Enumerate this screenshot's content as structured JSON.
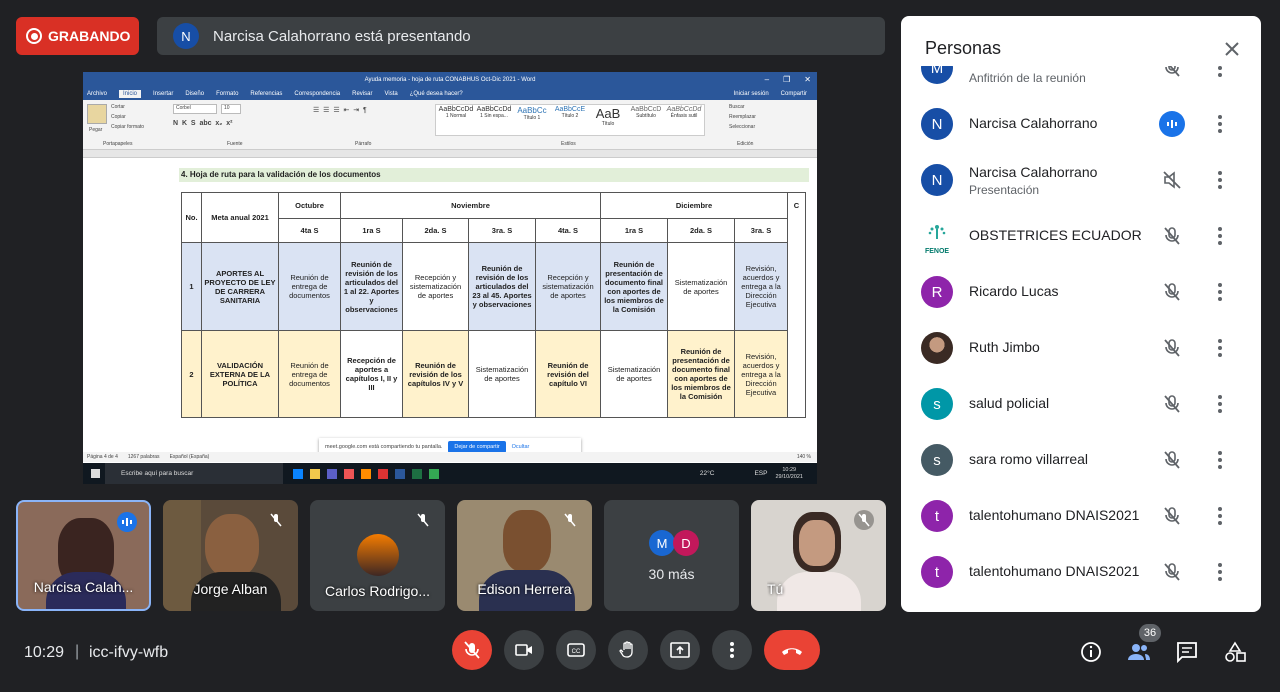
{
  "recording": {
    "label": "GRABANDO"
  },
  "presenting_banner": {
    "initial": "N",
    "text": "Narcisa Calahorrano está presentando"
  },
  "word": {
    "title": "Ayuda memoria - hoja de ruta CONABHUS Oct-Dic 2021 - Word",
    "tabs": [
      "Archivo",
      "Inicio",
      "Insertar",
      "Diseño",
      "Formato",
      "Referencias",
      "Correspondencia",
      "Revisar",
      "Vista",
      "¿Qué desea hacer?"
    ],
    "account": "Iniciar sesión",
    "share": "Compartir",
    "clipboard": [
      "Cortar",
      "Copiar",
      "Copiar formato"
    ],
    "paste": "Pegar",
    "font_name": "Corbel",
    "font_size": "10",
    "styles": [
      {
        "sample": "AaBbCcDd",
        "name": "1 Normal"
      },
      {
        "sample": "AaBbCcDd",
        "name": "1 Sin espa..."
      },
      {
        "sample": "AaBbCc",
        "name": "Título 1"
      },
      {
        "sample": "AaBbCcE",
        "name": "Título 2"
      },
      {
        "sample": "AaB",
        "name": "Título"
      },
      {
        "sample": "AaBbCcD",
        "name": "Subtítulo"
      },
      {
        "sample": "AaBbCcDd",
        "name": "Énfasis sutil"
      }
    ],
    "editing": [
      "Buscar",
      "Reemplazar",
      "Seleccionar"
    ],
    "group_labels": [
      "Portapapeles",
      "Fuente",
      "Párrafo",
      "Estilos",
      "Edición"
    ],
    "heading": "4.    Hoja de ruta para la validación de los documentos",
    "table": {
      "col_no": "No.",
      "col_meta": "Meta anual 2021",
      "months": [
        "Octubre",
        "Noviembre",
        "Diciembre",
        "C"
      ],
      "weeks": [
        "4ta S",
        "1ra S",
        "2da. S",
        "3ra. S",
        "4ta. S",
        "1ra S",
        "2da. S",
        "3ra. S"
      ],
      "rows": [
        {
          "no": "1",
          "meta": "APORTES AL PROYECTO DE LEY DE CARRERA SANITARIA",
          "cells": [
            "Reunión de entrega de documentos",
            "Reunión de revisión de los articulados del 1 al 22. Aportes y observaciones",
            "Recepción y sistematización de aportes",
            "Reunión de revisión de los articulados del 23 al 45. Aportes y observaciones",
            "Recepción y sistematización de aportes",
            "Reunión de presentación de documento final con aportes de los miembros de la Comisión",
            "Sistematización de aportes",
            "Revisión, acuerdos y entrega a la Dirección Ejecutiva"
          ]
        },
        {
          "no": "2",
          "meta": "VALIDACIÓN EXTERNA DE LA POLÍTICA",
          "cells": [
            "Reunión de entrega de documentos",
            "Recepción de aportes a capítulos I, II y III",
            "Reunión de revisión de los capítulos IV y V",
            "Sistematización de aportes",
            "Reunión de revisión del capítulo VI",
            "Sistematización de aportes",
            "Reunión de presentación de documento final con aportes de los miembros de la Comisión",
            "Revisión, acuerdos y entrega a la Dirección Ejecutiva"
          ]
        }
      ]
    },
    "sharebar": {
      "text": "meet.google.com está compartiendo tu pantalla.",
      "stop": "Dejar de compartir",
      "hide": "Ocultar"
    },
    "status": {
      "page": "Página 4 de 4",
      "words": "1267 palabras",
      "lang": "Español (España)",
      "zoom": "140 %"
    },
    "taskbar": {
      "search": "Escribe aquí para buscar",
      "temp": "22°C",
      "lang": "ESP",
      "time": "10:29",
      "date": "29/10/2021"
    }
  },
  "tiles": [
    {
      "name": "Narcisa Calah...",
      "speaking": true
    },
    {
      "name": "Jorge Alban",
      "muted": true
    },
    {
      "name": "Carlos Rodrigo...",
      "muted": true
    },
    {
      "name": "Edison Herrera",
      "muted": true
    },
    {
      "more_label": "30 más",
      "initials": [
        "M",
        "D"
      ]
    },
    {
      "name": "Tú",
      "muted": true
    }
  ],
  "people_panel": {
    "title": "Personas",
    "people": [
      {
        "initial": "M",
        "name": "",
        "sub": "Anfitrión de la reunión",
        "color": "#174ea6",
        "mic": "off"
      },
      {
        "initial": "N",
        "name": "Narcisa Calahorrano",
        "sub": "",
        "color": "#174ea6",
        "mic": "speaking"
      },
      {
        "initial": "N",
        "name": "Narcisa Calahorrano",
        "sub": "Presentación",
        "color": "#174ea6",
        "mic": "audio-off"
      },
      {
        "initial": "",
        "name": "OBSTETRICES ECUADOR",
        "sub": "",
        "color": "#ffffff",
        "logo": "FENOE",
        "mic": "off"
      },
      {
        "initial": "R",
        "name": "Ricardo Lucas",
        "sub": "",
        "color": "#8e24aa",
        "mic": "off"
      },
      {
        "initial": "",
        "name": "Ruth Jimbo",
        "sub": "",
        "color": "#5d4037",
        "photo": true,
        "mic": "off"
      },
      {
        "initial": "s",
        "name": "salud policial",
        "sub": "",
        "color": "#0097a7",
        "mic": "off"
      },
      {
        "initial": "s",
        "name": "sara romo villarreal",
        "sub": "",
        "color": "#455a64",
        "mic": "off"
      },
      {
        "initial": "t",
        "name": "talentohumano DNAIS2021",
        "sub": "",
        "color": "#8e24aa",
        "mic": "off"
      },
      {
        "initial": "t",
        "name": "talentohumano DNAIS2021",
        "sub": "",
        "color": "#8e24aa",
        "mic": "off"
      }
    ]
  },
  "bottom_bar": {
    "time": "10:29",
    "separator": "|",
    "code": "icc-ifvy-wfb",
    "participant_count": "36"
  },
  "colors": {
    "bg": "#202124",
    "tile": "#3c4043",
    "red": "#ea4335",
    "blue": "#8ab4f8"
  }
}
